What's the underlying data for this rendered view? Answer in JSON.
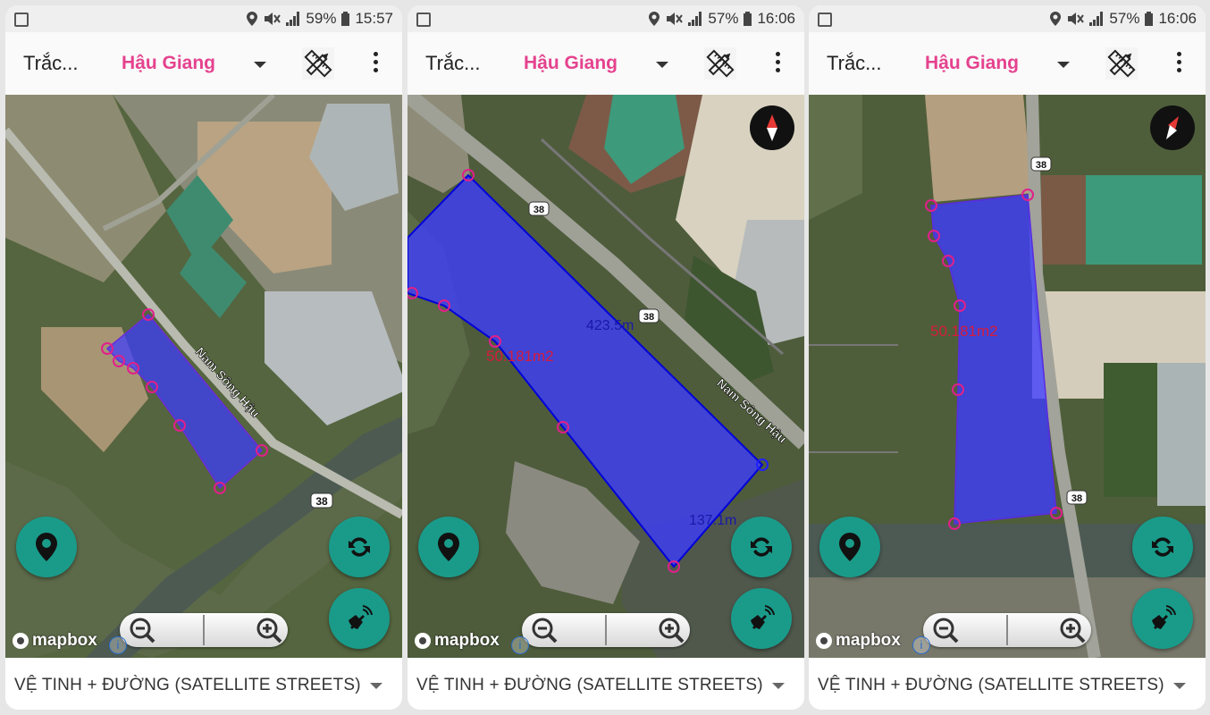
{
  "phones": [
    {
      "status": {
        "battery": "59%",
        "time": "15:57"
      },
      "app_title": "Trắc...",
      "province": "Hậu Giang",
      "map": {
        "road_label": "Nam Sông Hậu",
        "route_badge": "38",
        "area": "",
        "dist1": "",
        "dist2": ""
      },
      "attribution": "mapbox",
      "layer_select": "VỆ TINH + ĐƯỜNG (SATELLITE STREETS)"
    },
    {
      "status": {
        "battery": "57%",
        "time": "16:06"
      },
      "app_title": "Trắc...",
      "province": "Hậu Giang",
      "map": {
        "road_label": "Nam Sông Hậu",
        "route_badge": "38",
        "area": "50.181m2",
        "dist1": "423.5m",
        "dist2": "137.1m"
      },
      "attribution": "mapbox",
      "layer_select": "VỆ TINH + ĐƯỜNG (SATELLITE STREETS)"
    },
    {
      "status": {
        "battery": "57%",
        "time": "16:06"
      },
      "app_title": "Trắc...",
      "province": "Hậu Giang",
      "map": {
        "road_label": "",
        "route_badge": "38",
        "area": "50.181m2",
        "dist1": "",
        "dist2": ""
      },
      "attribution": "mapbox",
      "layer_select": "VỆ TINH + ĐƯỜNG (SATELLITE STREETS)"
    }
  ],
  "colors": {
    "polygon_fill": "#3c3cff",
    "vertex": "#e0208a",
    "fab": "#1a9b8a",
    "province": "#e5428e"
  },
  "icons": [
    "image-icon",
    "location-icon",
    "mute-icon",
    "signal-icon",
    "battery-icon",
    "ruler-pencil-icon",
    "more-vert-icon",
    "location-pin-icon",
    "refresh-icon",
    "satellite-dish-icon",
    "zoom-out-icon",
    "zoom-in-icon",
    "compass-icon",
    "info-icon"
  ]
}
